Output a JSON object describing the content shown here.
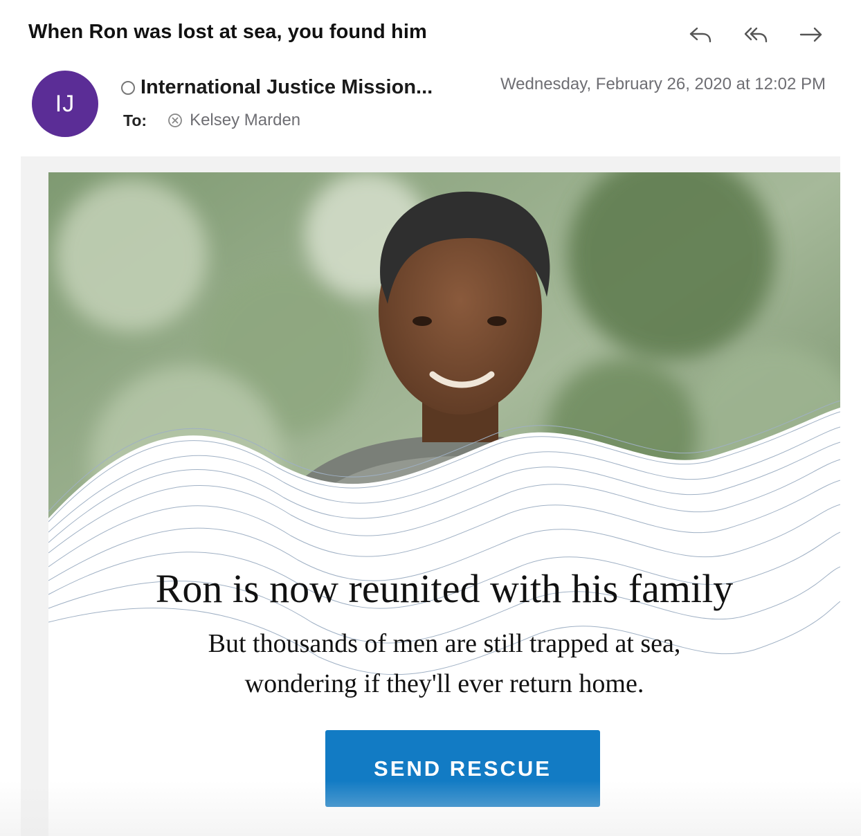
{
  "header": {
    "subject": "When Ron was lost at sea, you found him",
    "actions": [
      {
        "name": "reply",
        "icon": "reply-icon"
      },
      {
        "name": "reply-all",
        "icon": "reply-all-icon"
      },
      {
        "name": "forward",
        "icon": "forward-icon"
      }
    ],
    "avatar_initials": "IJ",
    "avatar_color": "#5b2d96",
    "sender": "International Justice Mission...",
    "date": "Wednesday, February 26, 2020 at 12:02 PM",
    "to_label": "To:",
    "recipient": "Kelsey Marden"
  },
  "email": {
    "headline": "Ron is now reunited with his family",
    "subline_1": "But thousands of men are still trapped at sea,",
    "subline_2": "wondering if they'll ever return home.",
    "cta_label": "SEND RESCUE",
    "cta_color": "#127bc4"
  }
}
